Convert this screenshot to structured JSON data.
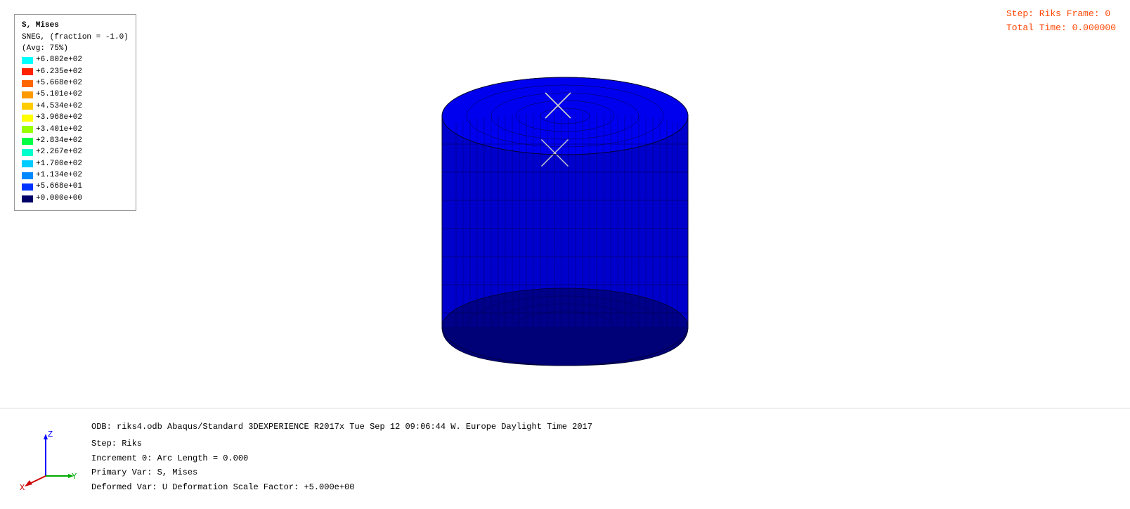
{
  "step_info": {
    "line1": "Step: Riks        Frame: 0",
    "line2": "Total Time: 0.000000"
  },
  "legend": {
    "title": "S, Mises",
    "subtitle": "SNEG, (fraction = -1.0)",
    "avg": "(Avg: 75%)",
    "entries": [
      {
        "color": "#00ffff",
        "value": "+6.802e+02"
      },
      {
        "color": "#ff2200",
        "value": "+6.235e+02"
      },
      {
        "color": "#ff6600",
        "value": "+5.668e+02"
      },
      {
        "color": "#ff9900",
        "value": "+5.101e+02"
      },
      {
        "color": "#ffcc00",
        "value": "+4.534e+02"
      },
      {
        "color": "#ffff00",
        "value": "+3.968e+02"
      },
      {
        "color": "#99ff00",
        "value": "+3.401e+02"
      },
      {
        "color": "#00ff44",
        "value": "+2.834e+02"
      },
      {
        "color": "#00ffcc",
        "value": "+2.267e+02"
      },
      {
        "color": "#00ccff",
        "value": "+1.700e+02"
      },
      {
        "color": "#0088ff",
        "value": "+1.134e+02"
      },
      {
        "color": "#0033ff",
        "value": "+5.668e+01"
      },
      {
        "color": "#000066",
        "value": "+0.000e+00"
      }
    ]
  },
  "bottom": {
    "odb_line": "ODB: riks4.odb    Abaqus/Standard 3DEXPERIENCE R2017x    Tue Sep 12 09:06:44 W. Europe Daylight Time 2017",
    "step_label": "Step: Riks",
    "increment_label": "Increment      0: Arc Length =     0.000",
    "primary_var": "Primary Var: S, Mises",
    "deformed_var": "Deformed Var: U   Deformation Scale Factor: +5.000e+00"
  },
  "axis": {
    "z_label": "Z",
    "y_label": "Y",
    "x_label": "X"
  }
}
